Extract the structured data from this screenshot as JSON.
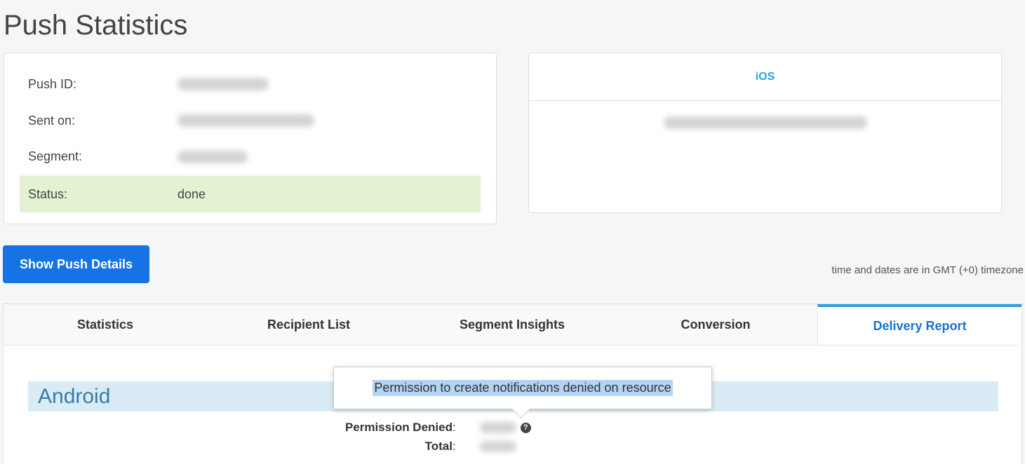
{
  "page": {
    "title": "Push Statistics"
  },
  "info": {
    "push_id_label": "Push ID:",
    "sent_on_label": "Sent on:",
    "segment_label": "Segment:",
    "status_label": "Status:",
    "status_value": "done"
  },
  "platform_card": {
    "title": "iOS"
  },
  "actions": {
    "show_details": "Show Push Details"
  },
  "timezone_note": "time and dates are in GMT (+0) timezone",
  "tabs": [
    {
      "label": "Statistics"
    },
    {
      "label": "Recipient List"
    },
    {
      "label": "Segment Insights"
    },
    {
      "label": "Conversion"
    },
    {
      "label": "Delivery Report"
    }
  ],
  "delivery_report": {
    "section_title": "Android",
    "permission_denied_label": "Permission Denied",
    "total_label": "Total",
    "help_icon_glyph": "?",
    "tooltip": "Permission to create notifications denied on resource"
  },
  "colors": {
    "primary_button": "#1673e6",
    "active_tab": "#1a73c9",
    "status_bg": "#e4f2d3",
    "section_band": "#d9ecf6"
  }
}
